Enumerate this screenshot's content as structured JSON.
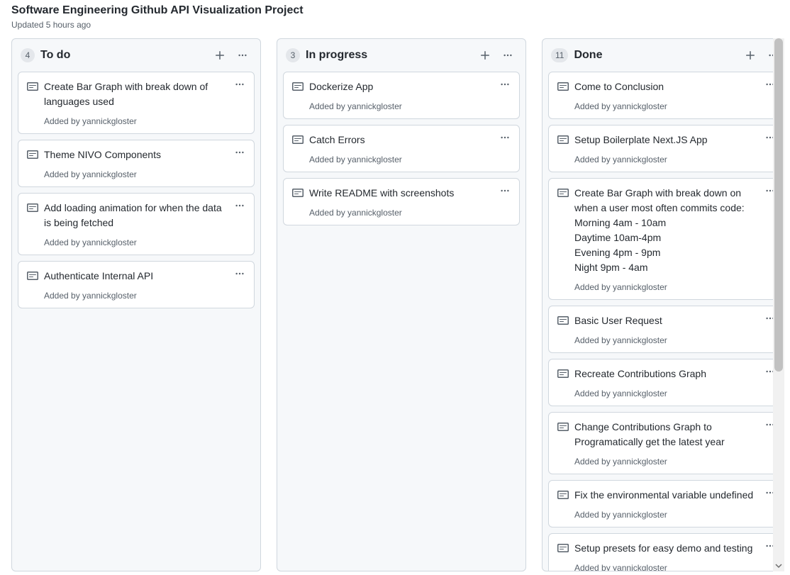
{
  "header": {
    "title": "Software Engineering Github API Visualization Project",
    "updated": "Updated 5 hours ago"
  },
  "added_prefix": "Added by ",
  "columns": [
    {
      "count": "4",
      "name": "To do",
      "cards": [
        {
          "title": "Create Bar Graph with break down of languages used",
          "author": "yannickgloster"
        },
        {
          "title": "Theme NIVO Components",
          "author": "yannickgloster"
        },
        {
          "title": "Add loading animation for when the data is being fetched",
          "author": "yannickgloster"
        },
        {
          "title": "Authenticate Internal API",
          "author": "yannickgloster"
        }
      ]
    },
    {
      "count": "3",
      "name": "In progress",
      "cards": [
        {
          "title": "Dockerize App",
          "author": "yannickgloster"
        },
        {
          "title": "Catch Errors",
          "author": "yannickgloster"
        },
        {
          "title": "Write README with screenshots",
          "author": "yannickgloster"
        }
      ]
    },
    {
      "count": "11",
      "name": "Done",
      "cards": [
        {
          "title": "Come to Conclusion",
          "author": "yannickgloster"
        },
        {
          "title": "Setup Boilerplate Next.JS App",
          "author": "yannickgloster"
        },
        {
          "title": "Create Bar Graph with break down on when a user most often commits code:\nMorning 4am - 10am\nDaytime 10am-4pm\nEvening 4pm - 9pm\nNight 9pm - 4am",
          "author": "yannickgloster"
        },
        {
          "title": "Basic User Request",
          "author": "yannickgloster"
        },
        {
          "title": "Recreate Contributions Graph",
          "author": "yannickgloster"
        },
        {
          "title": "Change Contributions Graph to Programatically get the latest year",
          "author": "yannickgloster"
        },
        {
          "title": "Fix the environmental variable undefined",
          "author": "yannickgloster"
        },
        {
          "title": "Setup presets for easy demo and testing",
          "author": "yannickgloster"
        }
      ]
    }
  ]
}
